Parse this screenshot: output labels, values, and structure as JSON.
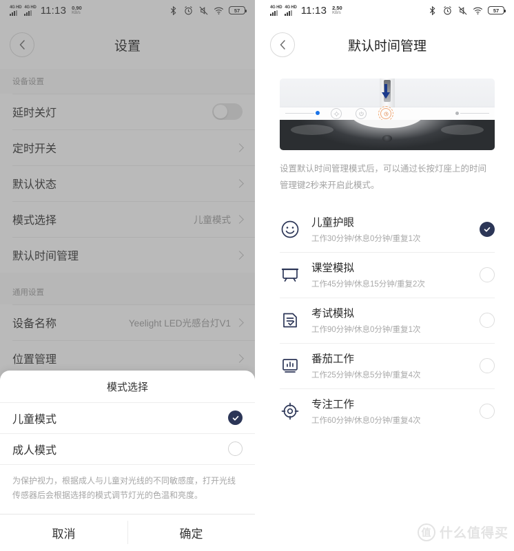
{
  "status_bar": {
    "network_label": "4G HD",
    "time": "11:13",
    "speed_left_value": "0.90",
    "speed_left_unit": "KB/s",
    "speed_right_value": "2.50",
    "speed_right_unit": "KB/s",
    "battery_percent": "57",
    "icons": [
      "bluetooth-icon",
      "alarm-icon",
      "mute-icon",
      "wifi-icon",
      "battery-icon"
    ]
  },
  "left_screen": {
    "nav_title": "设置",
    "back_icon": "chevron-left-icon",
    "groups": [
      {
        "header": "设备设置",
        "rows": [
          {
            "label": "延时关灯",
            "control": "toggle",
            "toggle_on": false
          },
          {
            "label": "定时开关",
            "control": "chevron",
            "value": ""
          },
          {
            "label": "默认状态",
            "control": "chevron",
            "value": ""
          },
          {
            "label": "模式选择",
            "control": "chevron",
            "value": "儿童模式"
          },
          {
            "label": "默认时间管理",
            "control": "chevron",
            "value": ""
          }
        ]
      },
      {
        "header": "通用设置",
        "rows": [
          {
            "label": "设备名称",
            "control": "chevron",
            "value": "Yeelight LED光感台灯V1"
          },
          {
            "label": "位置管理",
            "control": "chevron",
            "value": ""
          }
        ]
      }
    ]
  },
  "sheet": {
    "title": "模式选择",
    "options": [
      {
        "label": "儿童模式",
        "selected": true
      },
      {
        "label": "成人模式",
        "selected": false
      }
    ],
    "description": "为保护视力，根据成人与儿童对光线的不同敏感度，打开光线传感器后会根据选择的模式调节灯光的色温和亮度。",
    "cancel_label": "取消",
    "confirm_label": "确定"
  },
  "right_screen": {
    "nav_title": "默认时间管理",
    "back_icon": "chevron-left-icon",
    "hero_alt": "lamp-base-illustration",
    "description": "设置默认时间管理模式后，可以通过长按灯座上的时间管理键2秒来开启此模式。",
    "modes": [
      {
        "icon": "smiley-face-icon",
        "name": "儿童护眼",
        "detail": "工作30分钟/休息0分钟/重复1次",
        "selected": true
      },
      {
        "icon": "whiteboard-icon",
        "name": "课堂模拟",
        "detail": "工作45分钟/休息15分钟/重复2次",
        "selected": false
      },
      {
        "icon": "document-check-icon",
        "name": "考试模拟",
        "detail": "工作90分钟/休息0分钟/重复1次",
        "selected": false
      },
      {
        "icon": "bar-chart-icon",
        "name": "番茄工作",
        "detail": "工作25分钟/休息5分钟/重复4次",
        "selected": false
      },
      {
        "icon": "target-icon",
        "name": "专注工作",
        "detail": "工作60分钟/休息0分钟/重复4次",
        "selected": false
      }
    ]
  },
  "watermark": {
    "text": "什么值得买",
    "badge": "值"
  },
  "colors": {
    "accent": "#2c3657",
    "blue_dot": "#1a73e8",
    "highlight_ring": "#f2a870"
  }
}
